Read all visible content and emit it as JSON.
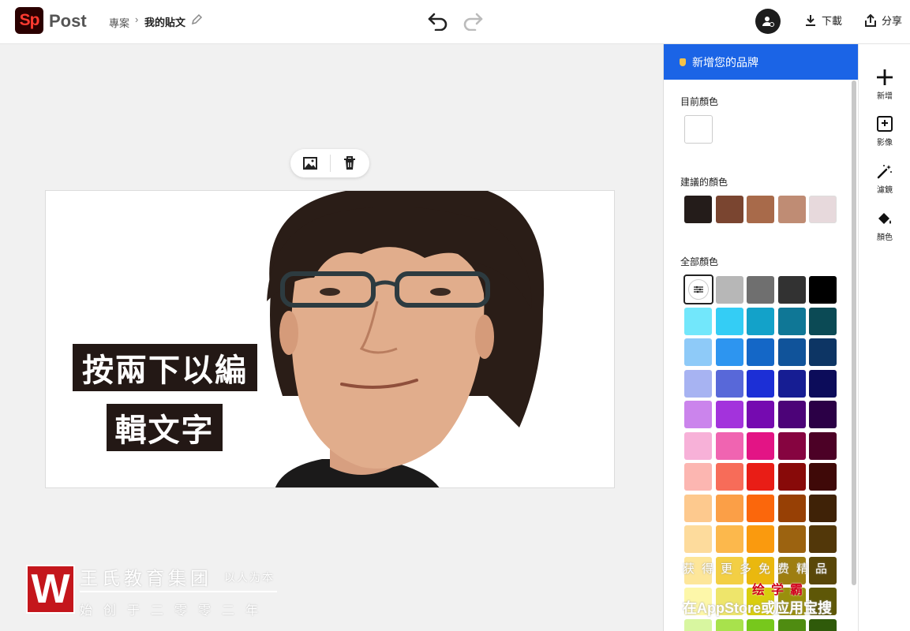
{
  "header": {
    "logo_text": "Sp",
    "app_name": "Post",
    "breadcrumb_project": "專案",
    "breadcrumb_separator": "›",
    "breadcrumb_post": "我的貼文",
    "download_label": "下載",
    "share_label": "分享"
  },
  "canvas": {
    "text_line_1": "按兩下以編",
    "text_line_2": "輯文字"
  },
  "color_panel": {
    "title": "新增您的品牌",
    "current_label": "目前顏色",
    "current_color": "#ffffff",
    "suggested_label": "建議的顏色",
    "suggested_colors": [
      "#241c1a",
      "#7a4530",
      "#a86a4a",
      "#bf8c74",
      "#e7d9dc"
    ],
    "all_label": "全部顏色",
    "grid_colors": [
      [
        "custom",
        "#b7b7b7",
        "#6f6f6f",
        "#323232",
        "#000000"
      ],
      [
        "#72e7fb",
        "#34cdf5",
        "#13a2c9",
        "#0f7796",
        "#0b4a55"
      ],
      [
        "#8ecaf8",
        "#2d95f0",
        "#1467c7",
        "#10539a",
        "#0d3564"
      ],
      [
        "#a7b3f2",
        "#5868d9",
        "#1c2fd6",
        "#161d93",
        "#0c0c5a"
      ],
      [
        "#cb84ec",
        "#a333dc",
        "#750ab0",
        "#4c0378",
        "#2b0046"
      ],
      [
        "#f7b1d8",
        "#f064b1",
        "#e31485",
        "#860440",
        "#4c0126"
      ],
      [
        "#fcb6b1",
        "#f76c59",
        "#e91d16",
        "#880a09",
        "#3f0908"
      ],
      [
        "#fdc98e",
        "#fb9f47",
        "#fb670c",
        "#974005",
        "#3f2207"
      ],
      [
        "#fddb9c",
        "#fcb84c",
        "#fa9a0e",
        "#9c6310",
        "#523709"
      ],
      [
        "#fde69a",
        "#f3cf44",
        "#eab80e",
        "#9e7e11",
        "#594709"
      ],
      [
        "#fdf7a9",
        "#eee56b",
        "#d9cd0e",
        "#9a8f0c",
        "#5e5707"
      ],
      [
        "#d8f6a0",
        "#a8e24c",
        "#77c81c",
        "#4f8c11",
        "#2f5a0a"
      ]
    ]
  },
  "rail": {
    "add_label": "新增",
    "image_label": "影像",
    "filter_label": "濾鏡",
    "color_label": "顏色"
  },
  "watermark": {
    "logo_letter": "W",
    "title": "王氏教育集团",
    "subtitle": "以人为本",
    "year": "始创于二零零二年"
  },
  "promo": {
    "line1": "获得更多免费精品",
    "line2": "绘学霸",
    "line3": "在AppStore或应用宝搜"
  }
}
